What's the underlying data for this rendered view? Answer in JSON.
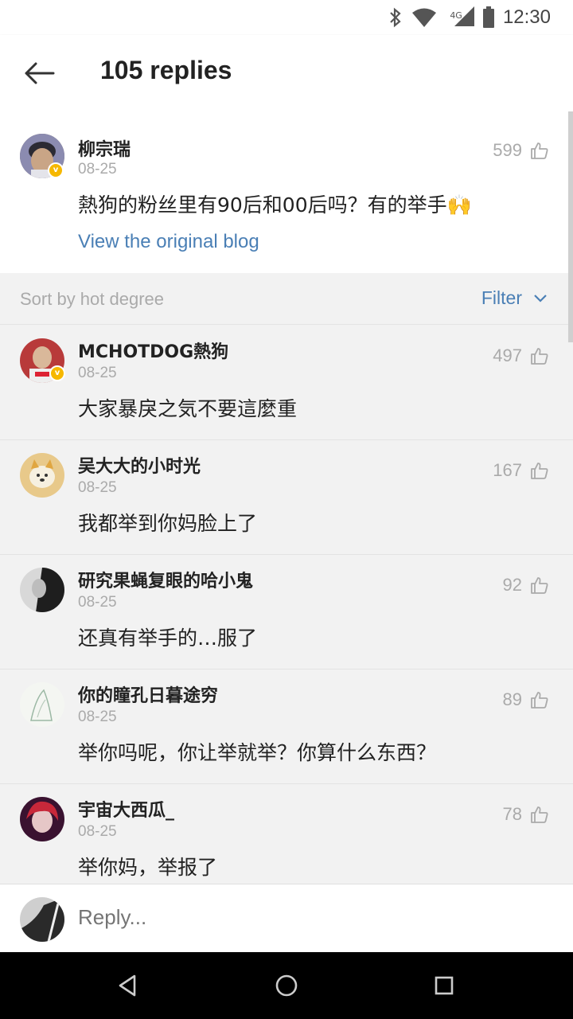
{
  "status_bar": {
    "time": "12:30",
    "network": "4G",
    "icons": [
      "bluetooth-icon",
      "wifi-icon",
      "signal-icon",
      "battery-icon"
    ]
  },
  "header": {
    "title": "105 replies",
    "back_icon": "arrow-left-icon"
  },
  "post": {
    "author": "柳宗瑞",
    "date": "08-25",
    "likes": "599",
    "verified": true,
    "text": "熱狗的粉丝里有90后和00后吗？有的举手",
    "emoji": "🙌",
    "link_text": "View the original blog"
  },
  "sort_bar": {
    "label": "Sort by hot degree",
    "filter_label": "Filter"
  },
  "replies": [
    {
      "name": "MCHOTDOG熱狗",
      "date": "08-25",
      "likes": "497",
      "text": "大家暴戾之気不要這麼重",
      "verified": true
    },
    {
      "name": "吴大大的小时光",
      "date": "08-25",
      "likes": "167",
      "text": "我都举到你妈脸上了",
      "verified": false
    },
    {
      "name": "研究果蝇复眼的哈小鬼",
      "date": "08-25",
      "likes": "92",
      "text": "还真有举手的…服了",
      "verified": false
    },
    {
      "name": "你的瞳孔日暮途穷",
      "date": "08-25",
      "likes": "89",
      "text": "举你吗呢，你让举就举？你算什么东西？",
      "verified": false
    },
    {
      "name": "宇宙大西瓜_",
      "date": "08-25",
      "likes": "78",
      "text": "举你妈，举报了",
      "verified": false
    }
  ],
  "reply_bar": {
    "placeholder": "Reply..."
  },
  "colors": {
    "link": "#4a7fb5",
    "badge": "#f6b800",
    "muted": "#aaaaaa",
    "background": "#f2f2f2"
  }
}
